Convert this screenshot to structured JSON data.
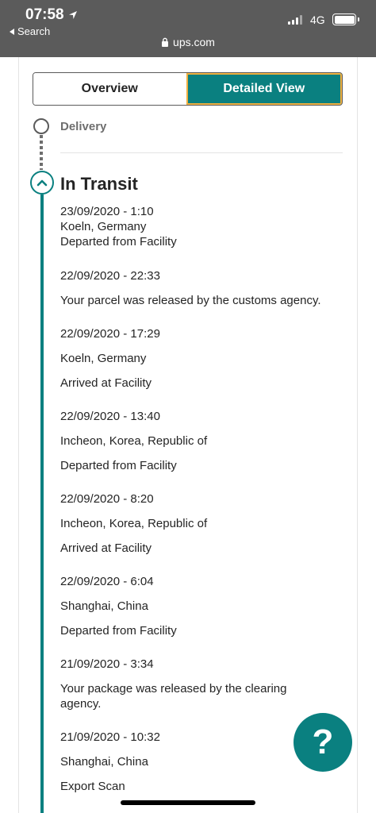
{
  "status_bar": {
    "time": "07:58",
    "back_label": "Search",
    "network": "4G"
  },
  "browser": {
    "url": "ups.com"
  },
  "toggle": {
    "overview": "Overview",
    "detailed": "Detailed View"
  },
  "timeline": {
    "delivery_label": "Delivery",
    "transit_title": "In Transit",
    "events": [
      {
        "datetime": "23/09/2020 - 1:10",
        "location": "Koeln, Germany",
        "status": "Departed from Facility"
      },
      {
        "datetime": "22/09/2020 - 22:33",
        "status": "Your parcel was released by the customs agency."
      },
      {
        "datetime": "22/09/2020 - 17:29",
        "location": "Koeln, Germany",
        "status": "Arrived at Facility"
      },
      {
        "datetime": "22/09/2020 - 13:40",
        "location": "Incheon, Korea, Republic of",
        "status": "Departed from Facility"
      },
      {
        "datetime": "22/09/2020 - 8:20",
        "location": "Incheon, Korea, Republic of",
        "status": "Arrived at Facility"
      },
      {
        "datetime": "22/09/2020 - 6:04",
        "location": "Shanghai, China",
        "status": "Departed from Facility"
      },
      {
        "datetime": "21/09/2020 - 3:34",
        "status": "Your package was released by the clearing agency."
      },
      {
        "datetime": "21/09/2020 - 10:32",
        "location": "Shanghai, China",
        "status": "Export Scan"
      }
    ]
  },
  "help": {
    "label": "?"
  },
  "colors": {
    "accent": "#0a8080",
    "focus_border": "#f0b040",
    "statusbar": "#5b5b5b"
  }
}
